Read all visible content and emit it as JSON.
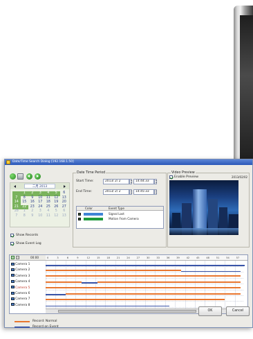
{
  "window": {
    "title": "Date/Time Search Dialog  [192.168.1.50]"
  },
  "calendar": {
    "month_label": "二月 2013",
    "rows": [
      [
        "",
        "",
        "1",
        "2",
        "3",
        "4",
        "5",
        "6"
      ],
      [
        "",
        "7",
        "8",
        "9",
        "10",
        "11",
        "12",
        "13"
      ],
      [
        "",
        "14",
        "15",
        "16",
        "17",
        "18",
        "19",
        "20"
      ],
      [
        "",
        "21",
        "22",
        "23",
        "24",
        "25",
        "26",
        "27"
      ],
      [
        "",
        "28",
        "1",
        "2",
        "3",
        "4",
        "5",
        "6"
      ],
      [
        "",
        "7",
        "8",
        "9",
        "10",
        "11",
        "12",
        "13"
      ]
    ]
  },
  "options": {
    "show_records": "Show Records",
    "show_event_log": "Show Event Log"
  },
  "datetime": {
    "group_title": "Date Time Period",
    "start_label": "Start Time:",
    "start_date": "2013/ 2/ 2",
    "start_time": "14:44:33",
    "end_label": "End Time:",
    "end_date": "2013/ 2/ 2",
    "end_time": "14:45:33"
  },
  "event_table": {
    "headers": [
      "Color",
      "Event Type"
    ],
    "rows": [
      {
        "name": "Signal Lost",
        "color": "#3f84d6"
      },
      {
        "name": "Motion From Camera",
        "color": "#1e9a3c"
      }
    ]
  },
  "preview": {
    "group_title": "Video Preview",
    "enable_label": "Enable Preview",
    "timestamp": "2013/02/02"
  },
  "timeline": {
    "zoom_label": "00:00",
    "ticks": [
      "0",
      "3",
      "6",
      "9",
      "12",
      "15",
      "18",
      "21",
      "24",
      "27",
      "30",
      "33",
      "36",
      "39",
      "42",
      "45",
      "48",
      "51",
      "54",
      "57"
    ],
    "cameras": [
      "Camera 1",
      "Camera 2",
      "Camera 3",
      "Camera 4",
      "Camera 5",
      "Camera 6",
      "Camera 7",
      "Camera 8"
    ],
    "tracks": [
      {
        "normal": [],
        "event": [
          [
            0.0,
            1.0
          ]
        ]
      },
      {
        "normal": [
          [
            0.0,
            0.68
          ]
        ],
        "event": [
          [
            0.68,
            0.98
          ]
        ]
      },
      {
        "normal": [
          [
            0.0,
            0.98
          ]
        ],
        "event": []
      },
      {
        "normal": [
          [
            0.0,
            0.18
          ],
          [
            0.26,
            0.98
          ]
        ],
        "event": [
          [
            0.18,
            0.26
          ]
        ]
      },
      {
        "normal": [
          [
            0.0,
            0.98
          ]
        ],
        "event": []
      },
      {
        "normal": [
          [
            0.1,
            0.98
          ]
        ],
        "event": [
          [
            0.0,
            0.1
          ]
        ]
      },
      {
        "normal": [
          [
            0.0,
            0.9
          ]
        ],
        "event": []
      },
      {
        "normal": [],
        "event": [
          [
            0.0,
            0.62
          ]
        ]
      }
    ]
  },
  "legend": {
    "normal_label": "Record: Normal",
    "event_label": "Record on Event",
    "normal_color": "#e8762f",
    "event_color": "#3a55a8"
  },
  "buttons": {
    "ok": "OK",
    "cancel": "Cancel"
  }
}
